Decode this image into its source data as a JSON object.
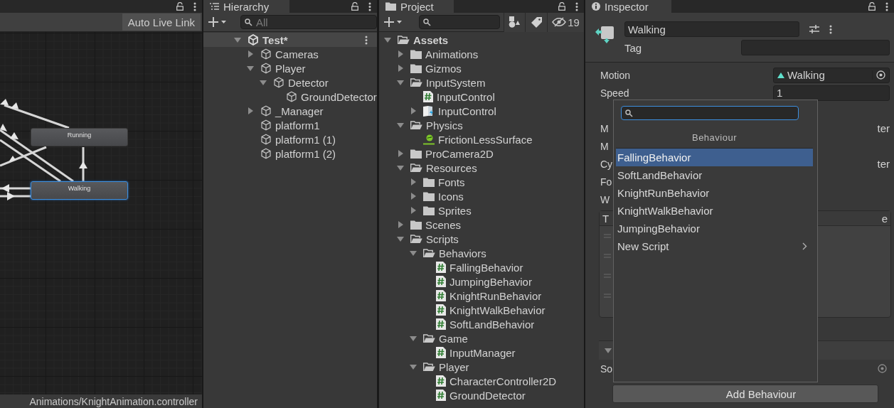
{
  "animator": {
    "auto_live_link": "Auto Live Link",
    "path": "Animations/KnightAnimation.controller",
    "states": [
      {
        "name": "Running",
        "selected": false
      },
      {
        "name": "Walking",
        "selected": true
      }
    ]
  },
  "hierarchy": {
    "title": "Hierarchy",
    "search": {
      "placeholder": "All"
    },
    "items": [
      {
        "name": "Test*",
        "kind": "scene",
        "expanded": true,
        "children": [
          {
            "name": "Cameras",
            "kind": "gameobject",
            "expanded": false
          },
          {
            "name": "Player",
            "kind": "gameobject",
            "expanded": true,
            "children": [
              {
                "name": "Detector",
                "kind": "gameobject",
                "expanded": true,
                "children": [
                  {
                    "name": "GroundDetector",
                    "kind": "gameobject"
                  }
                ]
              }
            ]
          },
          {
            "name": "_Manager",
            "kind": "gameobject",
            "expanded": false
          },
          {
            "name": "platform1",
            "kind": "gameobject"
          },
          {
            "name": "platform1 (1)",
            "kind": "gameobject"
          },
          {
            "name": "platform1 (2)",
            "kind": "gameobject"
          }
        ]
      }
    ]
  },
  "project": {
    "title": "Project",
    "hidden_count": "19",
    "items": [
      {
        "name": "Assets",
        "kind": "folder",
        "expanded": true,
        "children": [
          {
            "name": "Animations",
            "kind": "folder",
            "expanded": false
          },
          {
            "name": "Gizmos",
            "kind": "folder",
            "expanded": false
          },
          {
            "name": "InputSystem",
            "kind": "folder",
            "expanded": true,
            "children": [
              {
                "name": "InputControl",
                "kind": "script"
              },
              {
                "name": "InputControl",
                "kind": "input_actions",
                "expanded": false
              }
            ]
          },
          {
            "name": "Physics",
            "kind": "folder",
            "expanded": true,
            "children": [
              {
                "name": "FrictionLessSurface",
                "kind": "physics_material"
              }
            ]
          },
          {
            "name": "ProCamera2D",
            "kind": "folder",
            "expanded": false
          },
          {
            "name": "Resources",
            "kind": "folder",
            "expanded": true,
            "children": [
              {
                "name": "Fonts",
                "kind": "folder",
                "expanded": false
              },
              {
                "name": "Icons",
                "kind": "folder",
                "expanded": false
              },
              {
                "name": "Sprites",
                "kind": "folder",
                "expanded": false
              }
            ]
          },
          {
            "name": "Scenes",
            "kind": "folder",
            "expanded": false
          },
          {
            "name": "Scripts",
            "kind": "folder",
            "expanded": true,
            "children": [
              {
                "name": "Behaviors",
                "kind": "folder",
                "expanded": true,
                "children": [
                  {
                    "name": "FallingBehavior",
                    "kind": "script"
                  },
                  {
                    "name": "JumpingBehavior",
                    "kind": "script"
                  },
                  {
                    "name": "KnightRunBehavior",
                    "kind": "script"
                  },
                  {
                    "name": "KnightWalkBehavior",
                    "kind": "script"
                  },
                  {
                    "name": "SoftLandBehavior",
                    "kind": "script"
                  }
                ]
              },
              {
                "name": "Game",
                "kind": "folder",
                "expanded": true,
                "children": [
                  {
                    "name": "InputManager",
                    "kind": "script"
                  }
                ]
              },
              {
                "name": "Player",
                "kind": "folder",
                "expanded": true,
                "children": [
                  {
                    "name": "CharacterController2D",
                    "kind": "script"
                  },
                  {
                    "name": "GroundDetector",
                    "kind": "script"
                  }
                ]
              }
            ]
          }
        ]
      }
    ]
  },
  "inspector": {
    "title": "Inspector",
    "name": "Walking",
    "tag_label": "Tag",
    "motion": {
      "label": "Motion",
      "value": "Walking"
    },
    "speed": {
      "label": "Speed",
      "value": "1"
    },
    "hidden_rows": [
      {
        "left": "M",
        "right": "ter"
      },
      {
        "left": "M"
      },
      {
        "left": "Cy",
        "right": "ter"
      },
      {
        "left": "Fo"
      },
      {
        "left": "W"
      }
    ],
    "list_header": {
      "left": "T",
      "right": "e"
    },
    "script_label": "So",
    "add_button": "Add Behaviour",
    "popup": {
      "header": "Behaviour",
      "items": [
        {
          "label": "FallingBehavior",
          "kind": "script",
          "selected": true
        },
        {
          "label": "SoftLandBehavior",
          "kind": "script",
          "selected": false
        },
        {
          "label": "KnightRunBehavior",
          "kind": "script",
          "selected": false
        },
        {
          "label": "KnightWalkBehavior",
          "kind": "script",
          "selected": false
        },
        {
          "label": "JumpingBehavior",
          "kind": "script",
          "selected": false
        },
        {
          "label": "New Script",
          "kind": "submenu",
          "selected": false
        }
      ]
    }
  }
}
